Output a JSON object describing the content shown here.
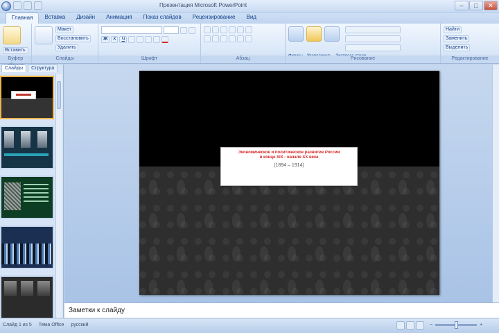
{
  "window": {
    "title": "Презентация Microsoft PowerPoint",
    "controls": [
      "–",
      "□",
      "✕"
    ]
  },
  "ribbon": {
    "tabs": [
      "Главная",
      "Вставка",
      "Дизайн",
      "Анимация",
      "Показ слайдов",
      "Рецензирование",
      "Вид"
    ],
    "groups": {
      "clipboard": {
        "label": "Буфер обмена",
        "paste": "Вставить"
      },
      "slides": {
        "label": "Слайды",
        "layout": "Макет",
        "reset": "Восстановить",
        "delete": "Удалить",
        "new_slide": "Создать слайд"
      },
      "font": {
        "label": "Шрифт"
      },
      "paragraph": {
        "label": "Абзац"
      },
      "drawing": {
        "label": "Рисование",
        "shapes": "Фигуры",
        "arrange": "Упорядочить",
        "quick_styles": "Экспресс-стили"
      },
      "editing": {
        "label": "Редактирование",
        "find": "Найти",
        "replace": "Заменить",
        "select": "Выделить"
      }
    }
  },
  "left_pane": {
    "tabs": [
      "Слайды",
      "Структура"
    ],
    "thumbnail_count": 5,
    "selected_index": 0
  },
  "slide": {
    "title_lines": [
      "Экономическое и политическое развитие России",
      "в конце XIX - начале XX века"
    ],
    "years": "(1894 – 1914)"
  },
  "notes": {
    "placeholder": "Заметки к слайду"
  },
  "status_bar": {
    "slide_info": "Слайд 1 из 5",
    "theme": "Тема Office",
    "language": "русский"
  },
  "colors": {
    "accent": "#d42626",
    "ribbon": "#dbe8f8",
    "slide_background": "#2e2e2e"
  }
}
